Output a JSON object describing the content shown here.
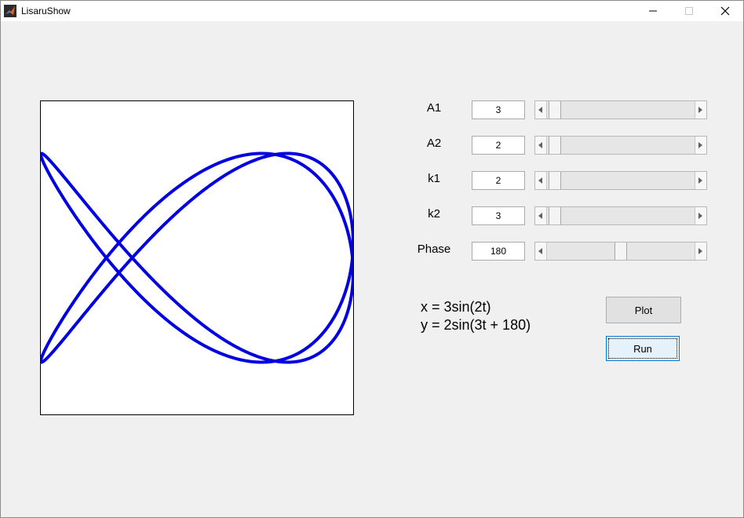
{
  "window": {
    "title": "LisaruShow",
    "icon": "matlab-icon",
    "controls": [
      "minimize-icon",
      "maximize-icon",
      "close-icon"
    ]
  },
  "params": [
    {
      "label": "A1",
      "value": "3",
      "slider_fraction": 0.02
    },
    {
      "label": "A2",
      "value": "2",
      "slider_fraction": 0.02
    },
    {
      "label": "k1",
      "value": "2",
      "slider_fraction": 0.02
    },
    {
      "label": "k2",
      "value": "3",
      "slider_fraction": 0.02
    },
    {
      "label": "Phase",
      "value": "180",
      "slider_fraction": 0.5
    }
  ],
  "formula": {
    "x": "x = 3sin(2t)",
    "y": "y = 2sin(3t + 180)"
  },
  "buttons": {
    "plot": "Plot",
    "run": "Run"
  },
  "chart_data": {
    "type": "line",
    "curve": "lissajous",
    "A1": 3,
    "A2": 2,
    "k1": 2,
    "k2": 3,
    "phase_deg": 180,
    "xlim": [
      -3,
      3
    ],
    "ylim": [
      -3,
      3
    ],
    "color": "#0000e0",
    "grid": false
  },
  "colors": {
    "plot_line": "#0000e0",
    "background": "#f0f0f0"
  }
}
